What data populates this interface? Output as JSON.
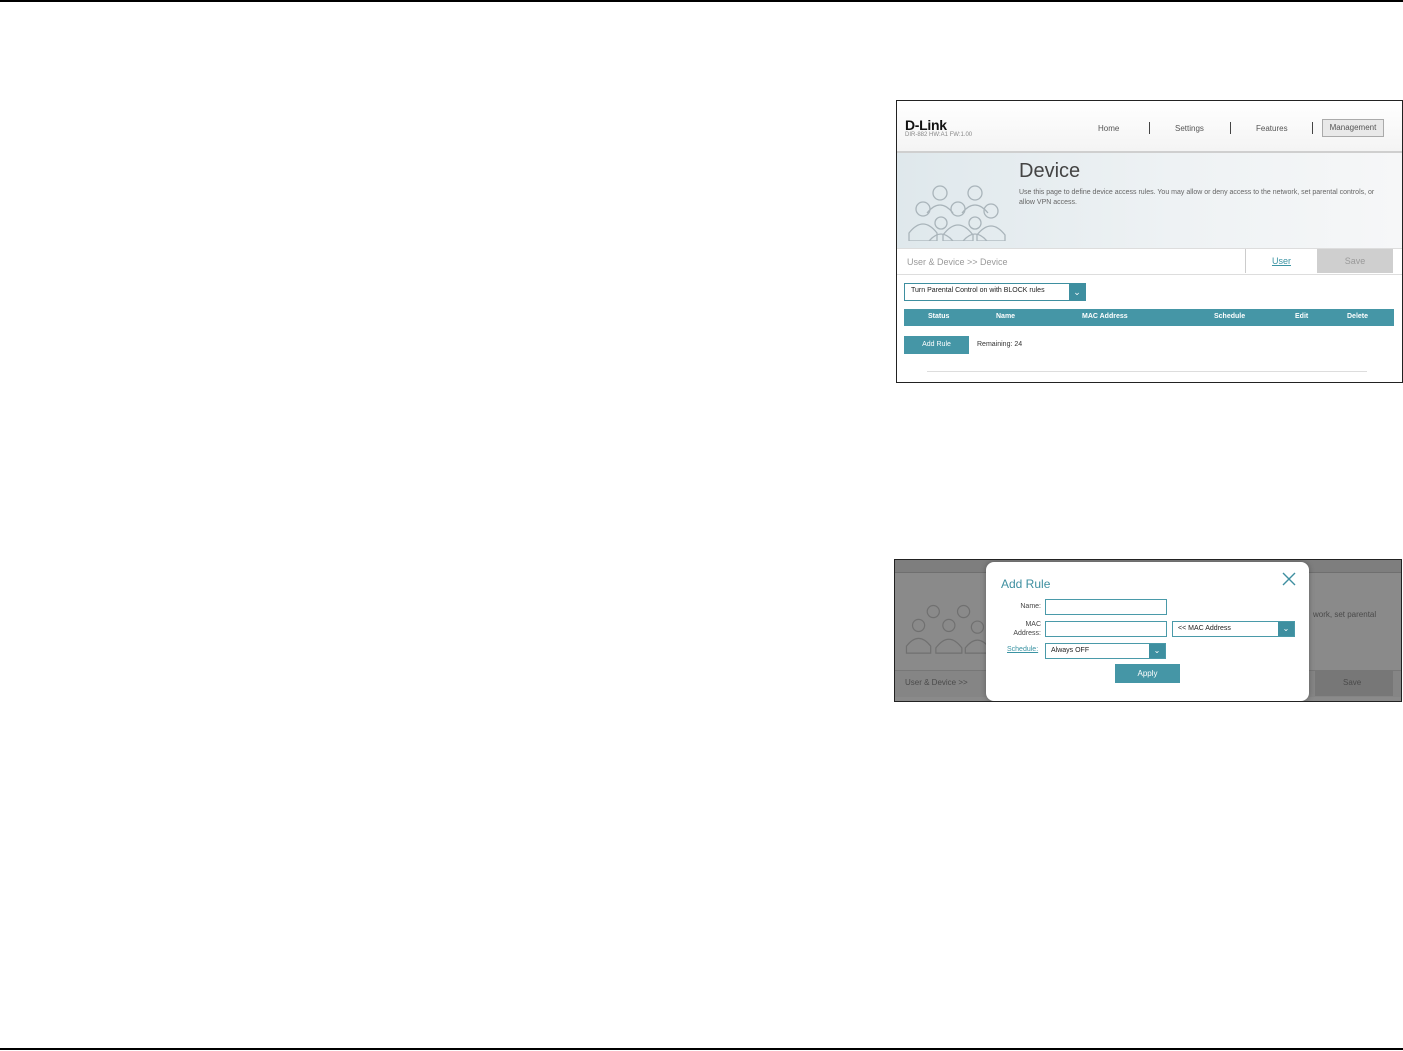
{
  "screenshot_device": {
    "brand": "D-Link",
    "firmware": "DIR-882 HW:A1 FW:1.00",
    "nav": [
      "Home",
      "Settings",
      "Features",
      "Management"
    ],
    "title": "Device",
    "description": "Use this page to define device access rules. You may allow or deny access to the network, set parental controls, or allow VPN access.",
    "breadcrumb": "User & Device >> Device",
    "user_tab": "User",
    "save": "Save",
    "parental_control": "Turn Parental Control on with BLOCK rules",
    "table_headers": [
      "Status",
      "Name",
      "MAC Address",
      "Schedule",
      "Edit",
      "Delete"
    ],
    "add_rule": "Add Rule",
    "remaining": "Remaining: 24"
  },
  "screenshot_add_rule": {
    "modal_title": "Add Rule",
    "name_label": "Name:",
    "mac_label_1": "MAC",
    "mac_label_2": "Address:",
    "mac_select": "<< MAC Address",
    "schedule_label": "Schedule:",
    "schedule_value": "Always OFF",
    "apply": "Apply",
    "bg_crumb": "User & Device >>",
    "bg_save": "Save",
    "bg_desc_fragment": "work, set parental"
  },
  "colors": {
    "accent": "#4596a6",
    "link": "#3a93a3"
  }
}
